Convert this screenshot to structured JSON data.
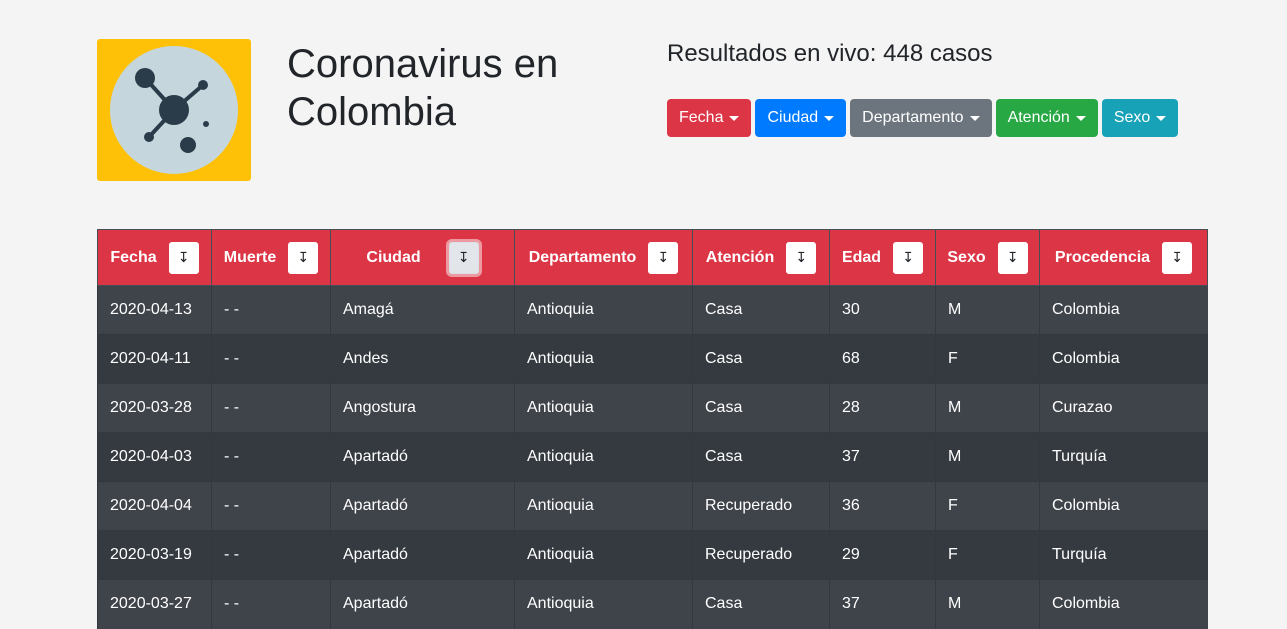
{
  "header": {
    "title": "Coronavirus en Colombia",
    "live_results": "Resultados en vivo: 448 casos",
    "logo_icon": "virus-network-icon"
  },
  "filters": [
    {
      "label": "Fecha",
      "color": "#dc3545"
    },
    {
      "label": "Ciudad",
      "color": "#007bff"
    },
    {
      "label": "Departamento",
      "color": "#6c757d"
    },
    {
      "label": "Atención",
      "color": "#28a745"
    },
    {
      "label": "Sexo",
      "color": "#17a2b8"
    }
  ],
  "table": {
    "sort_icon": "↧",
    "columns": [
      "Fecha",
      "Muerte",
      "Ciudad",
      "Departamento",
      "Atención",
      "Edad",
      "Sexo",
      "Procedencia"
    ],
    "rows": [
      [
        "2020-04-13",
        "- -",
        "Amagá",
        "Antioquia",
        "Casa",
        "30",
        "M",
        "Colombia"
      ],
      [
        "2020-04-11",
        "- -",
        "Andes",
        "Antioquia",
        "Casa",
        "68",
        "F",
        "Colombia"
      ],
      [
        "2020-03-28",
        "- -",
        "Angostura",
        "Antioquia",
        "Casa",
        "28",
        "M",
        "Curazao"
      ],
      [
        "2020-04-03",
        "- -",
        "Apartadó",
        "Antioquia",
        "Casa",
        "37",
        "M",
        "Turquía"
      ],
      [
        "2020-04-04",
        "- -",
        "Apartadó",
        "Antioquia",
        "Recuperado",
        "36",
        "F",
        "Colombia"
      ],
      [
        "2020-03-19",
        "- -",
        "Apartadó",
        "Antioquia",
        "Recuperado",
        "29",
        "F",
        "Turquía"
      ],
      [
        "2020-03-27",
        "- -",
        "Apartadó",
        "Antioquia",
        "Casa",
        "37",
        "M",
        "Colombia"
      ]
    ]
  }
}
